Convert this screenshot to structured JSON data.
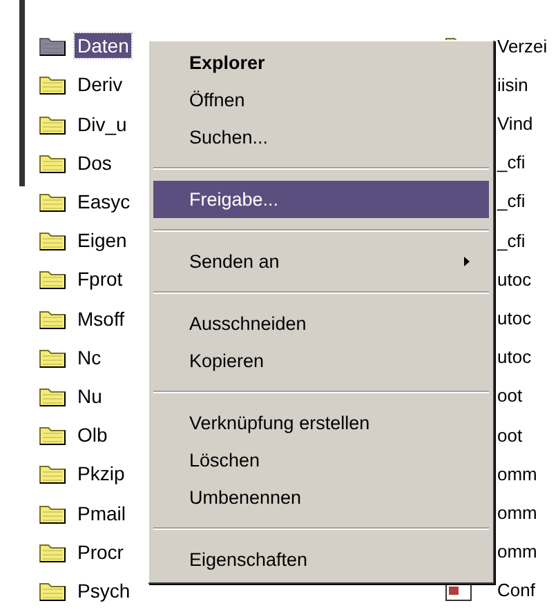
{
  "folders": [
    {
      "name": "Daten",
      "selected": true
    },
    {
      "name": "Deriv",
      "selected": false
    },
    {
      "name": "Div_u",
      "selected": false
    },
    {
      "name": "Dos",
      "selected": false
    },
    {
      "name": "Easyc",
      "selected": false
    },
    {
      "name": "Eigen",
      "selected": false
    },
    {
      "name": "Fprot",
      "selected": false
    },
    {
      "name": "Msoff",
      "selected": false
    },
    {
      "name": "Nc",
      "selected": false
    },
    {
      "name": "Nu",
      "selected": false
    },
    {
      "name": "Olb",
      "selected": false
    },
    {
      "name": "Pkzip",
      "selected": false
    },
    {
      "name": "Pmail",
      "selected": false
    },
    {
      "name": "Procr",
      "selected": false
    },
    {
      "name": "Psych",
      "selected": false
    }
  ],
  "right_column": [
    {
      "name": "Verzei",
      "kind": "folder"
    },
    {
      "name": "iisin",
      "kind": "none"
    },
    {
      "name": "Vind",
      "kind": "none"
    },
    {
      "name": "_cfi",
      "kind": "none"
    },
    {
      "name": "_cfi",
      "kind": "none"
    },
    {
      "name": "_cfi",
      "kind": "none"
    },
    {
      "name": "utoc",
      "kind": "none"
    },
    {
      "name": "utoc",
      "kind": "none"
    },
    {
      "name": "utoc",
      "kind": "none"
    },
    {
      "name": "oot",
      "kind": "none"
    },
    {
      "name": "oot",
      "kind": "none"
    },
    {
      "name": "omm",
      "kind": "none"
    },
    {
      "name": "omm",
      "kind": "none"
    },
    {
      "name": "omm",
      "kind": "none"
    },
    {
      "name": "Conf",
      "kind": "file"
    }
  ],
  "context_menu": [
    {
      "kind": "item",
      "label": "Explorer",
      "bold": true,
      "selected": false
    },
    {
      "kind": "item",
      "label": "Öffnen",
      "bold": false,
      "selected": false
    },
    {
      "kind": "item",
      "label": "Suchen...",
      "bold": false,
      "selected": false
    },
    {
      "kind": "separator"
    },
    {
      "kind": "item",
      "label": "Freigabe...",
      "bold": false,
      "selected": true
    },
    {
      "kind": "separator"
    },
    {
      "kind": "submenu",
      "label": "Senden an",
      "bold": false,
      "selected": false
    },
    {
      "kind": "separator"
    },
    {
      "kind": "item",
      "label": "Ausschneiden",
      "bold": false,
      "selected": false
    },
    {
      "kind": "item",
      "label": "Kopieren",
      "bold": false,
      "selected": false
    },
    {
      "kind": "separator"
    },
    {
      "kind": "item",
      "label": "Verknüpfung erstellen",
      "bold": false,
      "selected": false
    },
    {
      "kind": "item",
      "label": "Löschen",
      "bold": false,
      "selected": false
    },
    {
      "kind": "item",
      "label": "Umbenennen",
      "bold": false,
      "selected": false
    },
    {
      "kind": "separator"
    },
    {
      "kind": "item",
      "label": "Eigenschaften",
      "bold": false,
      "selected": false
    }
  ]
}
